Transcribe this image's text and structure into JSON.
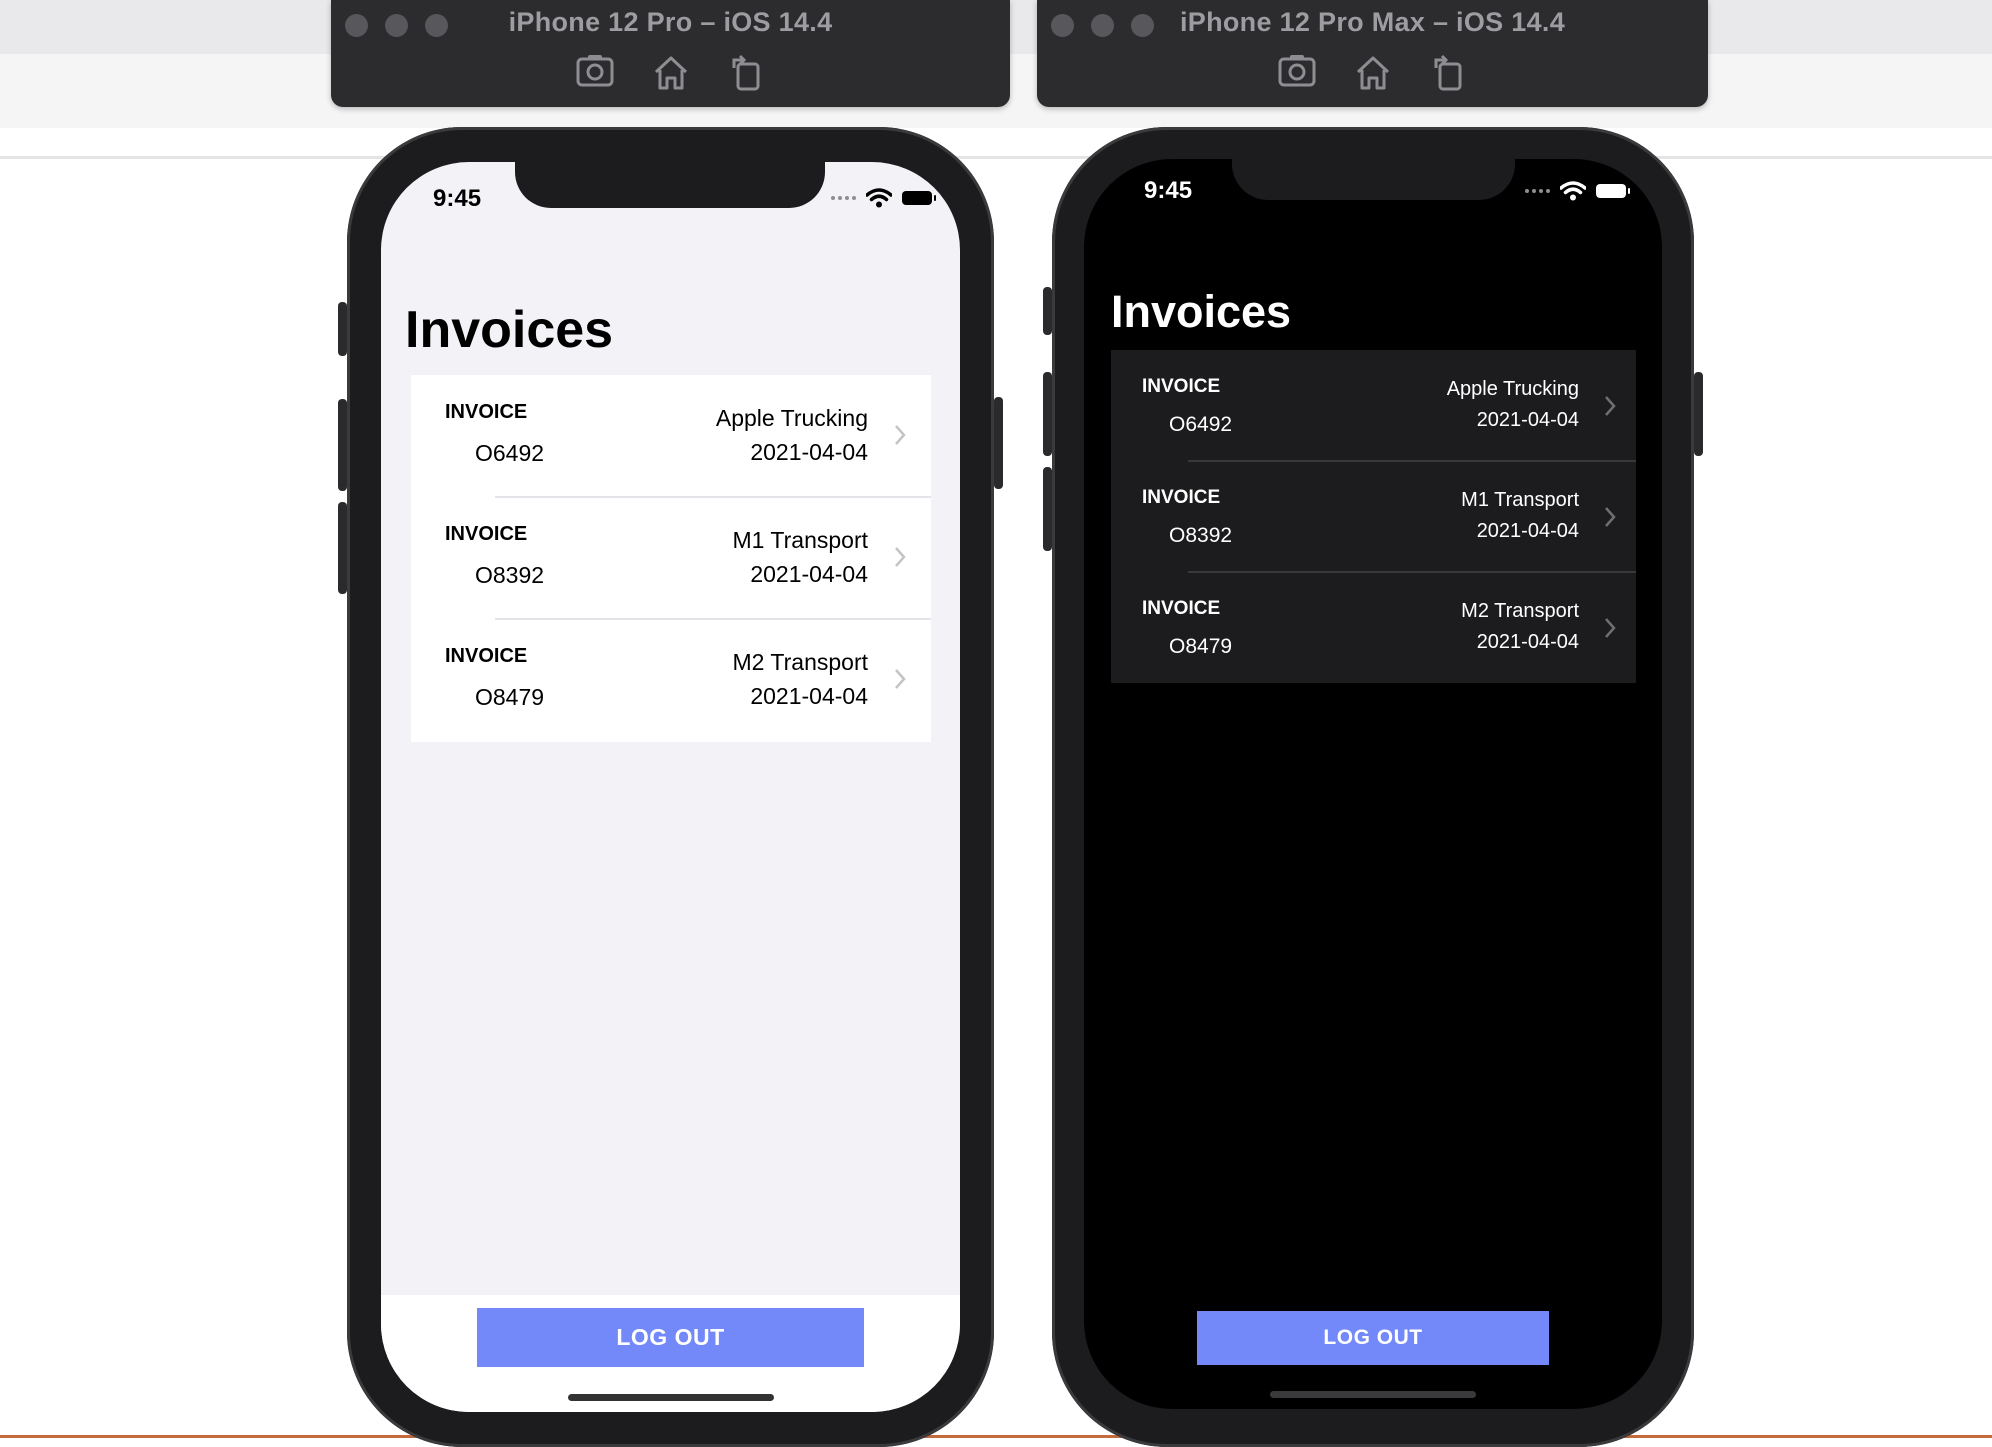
{
  "simulators": [
    {
      "title": "iPhone 12 Pro – iOS 14.4"
    },
    {
      "title": "iPhone 12 Pro Max – iOS 14.4"
    }
  ],
  "toolbar": {
    "icons": [
      "screenshot-icon",
      "home-icon",
      "rotate-icon"
    ]
  },
  "status": {
    "time": "9:45"
  },
  "page": {
    "title": "Invoices"
  },
  "invoices": [
    {
      "kind": "INVOICE",
      "number": "O6492",
      "company": "Apple Trucking",
      "date": "2021-04-04"
    },
    {
      "kind": "INVOICE",
      "number": "O8392",
      "company": "M1 Transport",
      "date": "2021-04-04"
    },
    {
      "kind": "INVOICE",
      "number": "O8479",
      "company": "M2 Transport",
      "date": "2021-04-04"
    }
  ],
  "logout": {
    "label": "LOG OUT"
  },
  "colors": {
    "accent": "#7388f9",
    "light_bg": "#f2f2f7",
    "dark_bg": "#000000",
    "dark_cell": "#1c1c1e"
  }
}
